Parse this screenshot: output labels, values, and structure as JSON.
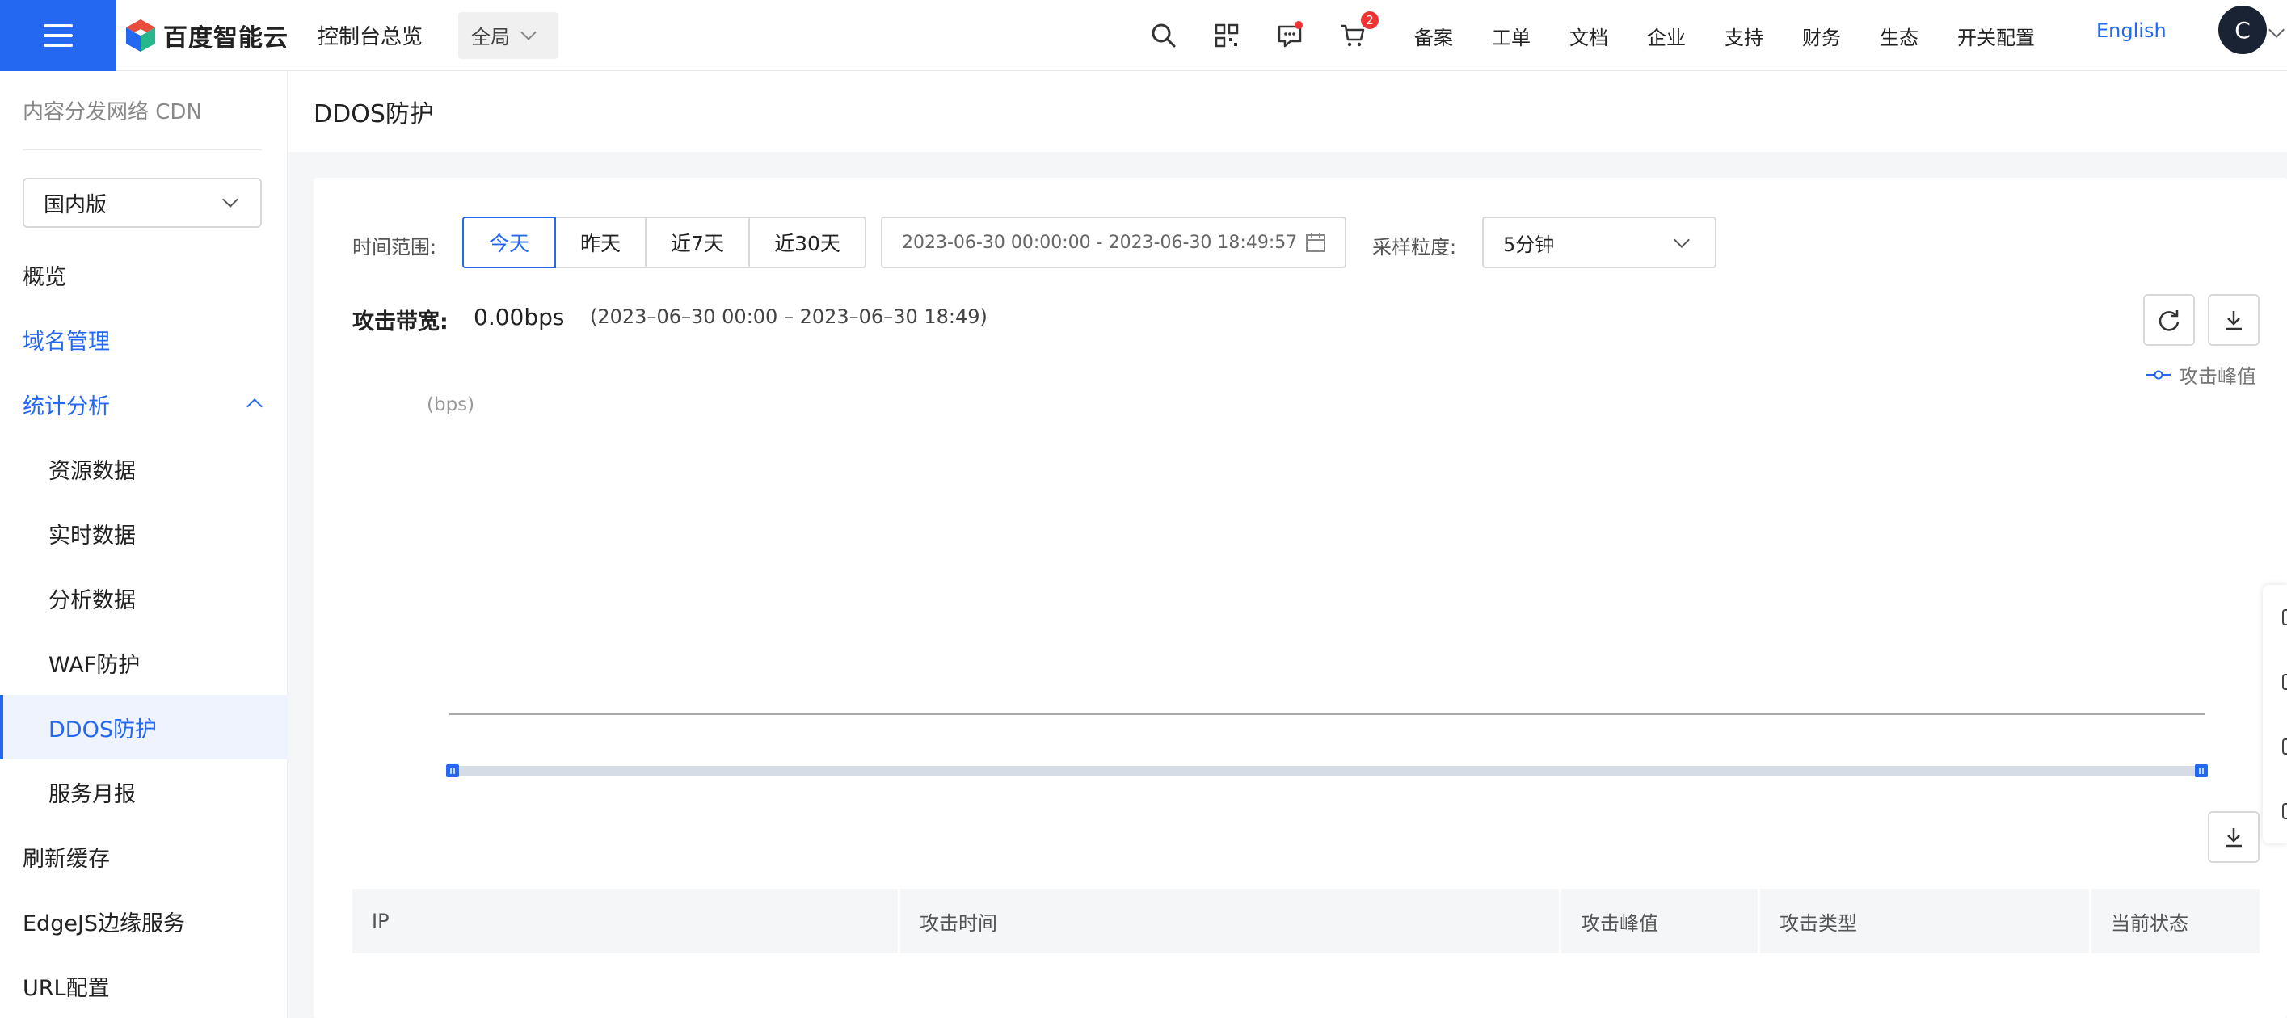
{
  "topbar": {
    "brand": "百度智能云",
    "console_title": "控制台总览",
    "region": "全局",
    "cart_count": "2",
    "links": [
      "备案",
      "工单",
      "文档",
      "企业",
      "支持",
      "财务",
      "生态",
      "开关配置"
    ],
    "language": "English",
    "avatar_initial": "C"
  },
  "sidebar": {
    "header": "内容分发网络 CDN",
    "edition": "国内版",
    "items": [
      {
        "label": "概览"
      },
      {
        "label": "域名管理"
      },
      {
        "label": "统计分析"
      },
      {
        "label": "资源数据"
      },
      {
        "label": "实时数据"
      },
      {
        "label": "分析数据"
      },
      {
        "label": "WAF防护"
      },
      {
        "label": "DDOS防护"
      },
      {
        "label": "服务月报"
      },
      {
        "label": "刷新缓存"
      },
      {
        "label": "EdgeJS边缘服务"
      },
      {
        "label": "URL配置"
      }
    ]
  },
  "main": {
    "page_title": "DDOS防护",
    "filters": {
      "time_range_label": "时间范围:",
      "time_buttons": [
        "今天",
        "昨天",
        "近7天",
        "近30天"
      ],
      "selected_time": "今天",
      "date_range": "2023-06-30 00:00:00 - 2023-06-30 18:49:57",
      "granularity_label": "采样粒度:",
      "granularity": "5分钟"
    },
    "bandwidth": {
      "label": "攻击带宽:",
      "value": "0.00bps",
      "range": "(2023–06–30 00:00 – 2023–06–30 18:49)"
    },
    "chart": {
      "legend": "攻击峰值",
      "unit": "(bps)",
      "accent": "#2468f2"
    },
    "table": {
      "columns": [
        "IP",
        "攻击时间",
        "攻击峰值",
        "攻击类型",
        "当前状态"
      ]
    }
  },
  "chart_data": {
    "type": "line",
    "series": [
      {
        "name": "攻击峰值",
        "values": []
      }
    ],
    "ylabel": "(bps)",
    "grid": false,
    "legend_position": "top-right"
  }
}
